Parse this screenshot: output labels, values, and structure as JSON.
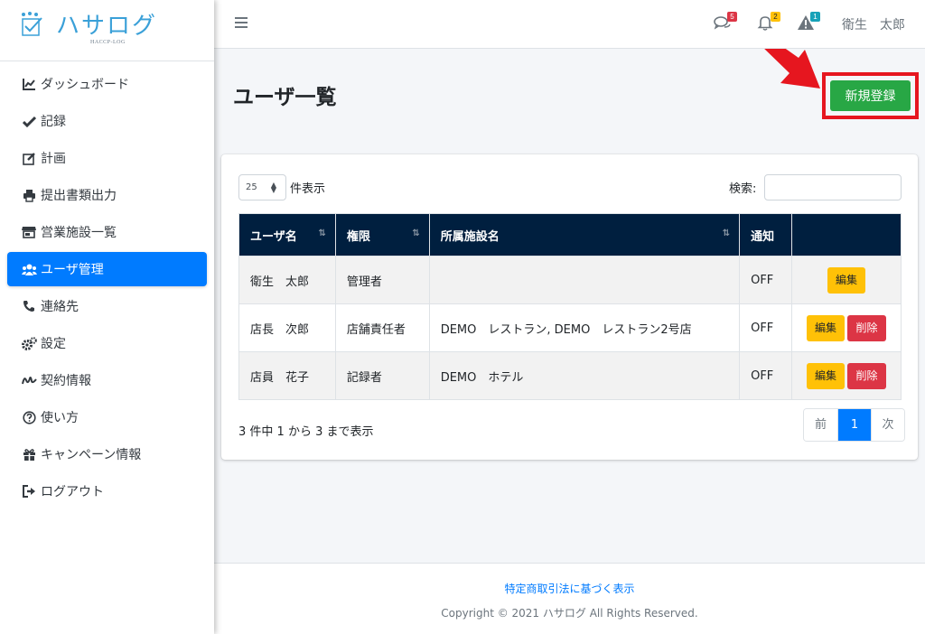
{
  "brand": {
    "name": "ハサログ",
    "subtitle": "HACCP-LOG"
  },
  "sidebar": {
    "items": [
      {
        "label": "ダッシュボード",
        "icon": "chart-line-icon"
      },
      {
        "label": "記録",
        "icon": "check-icon"
      },
      {
        "label": "計画",
        "icon": "edit-icon"
      },
      {
        "label": "提出書類出力",
        "icon": "printer-icon"
      },
      {
        "label": "営業施設一覧",
        "icon": "store-icon"
      },
      {
        "label": "ユーザ管理",
        "icon": "users-icon",
        "active": true
      },
      {
        "label": "連絡先",
        "icon": "phone-icon"
      },
      {
        "label": "設定",
        "icon": "gears-icon"
      },
      {
        "label": "契約情報",
        "icon": "signature-icon"
      },
      {
        "label": "使い方",
        "icon": "question-icon"
      },
      {
        "label": "キャンペーン情報",
        "icon": "gift-icon"
      },
      {
        "label": "ログアウト",
        "icon": "sign-out-icon"
      }
    ]
  },
  "header": {
    "messages_count": "5",
    "notifications_count": "2",
    "alerts_count": "1",
    "user_name": "衛生　太郎",
    "colors": {
      "messages": "#dc3545",
      "notifications": "#ffc107",
      "alerts": "#17a2b8"
    }
  },
  "main": {
    "title": "ユーザ一覧",
    "new_button_label": "新規登録",
    "length_value": "25",
    "length_label": "件表示",
    "search_label": "検索:",
    "search_placeholder": "",
    "columns": [
      "ユーザ名",
      "権限",
      "所属施設名",
      "通知",
      ""
    ],
    "rows": [
      {
        "name": "衛生　太郎",
        "role": "管理者",
        "facility": "",
        "notify": "OFF",
        "edit": "編集",
        "delete": ""
      },
      {
        "name": "店長　次郎",
        "role": "店舗責任者",
        "facility": "DEMO　レストラン, DEMO　レストラン2号店",
        "notify": "OFF",
        "edit": "編集",
        "delete": "削除"
      },
      {
        "name": "店員　花子",
        "role": "記録者",
        "facility": "DEMO　ホテル",
        "notify": "OFF",
        "edit": "編集",
        "delete": "削除"
      }
    ],
    "info": "3 件中 1 から 3 まで表示",
    "pagination": {
      "prev": "前",
      "current": "1",
      "next": "次"
    }
  },
  "footer": {
    "link": "特定商取引法に基づく表示",
    "copyright": "Copyright © 2021 ハサログ All Rights Reserved."
  }
}
